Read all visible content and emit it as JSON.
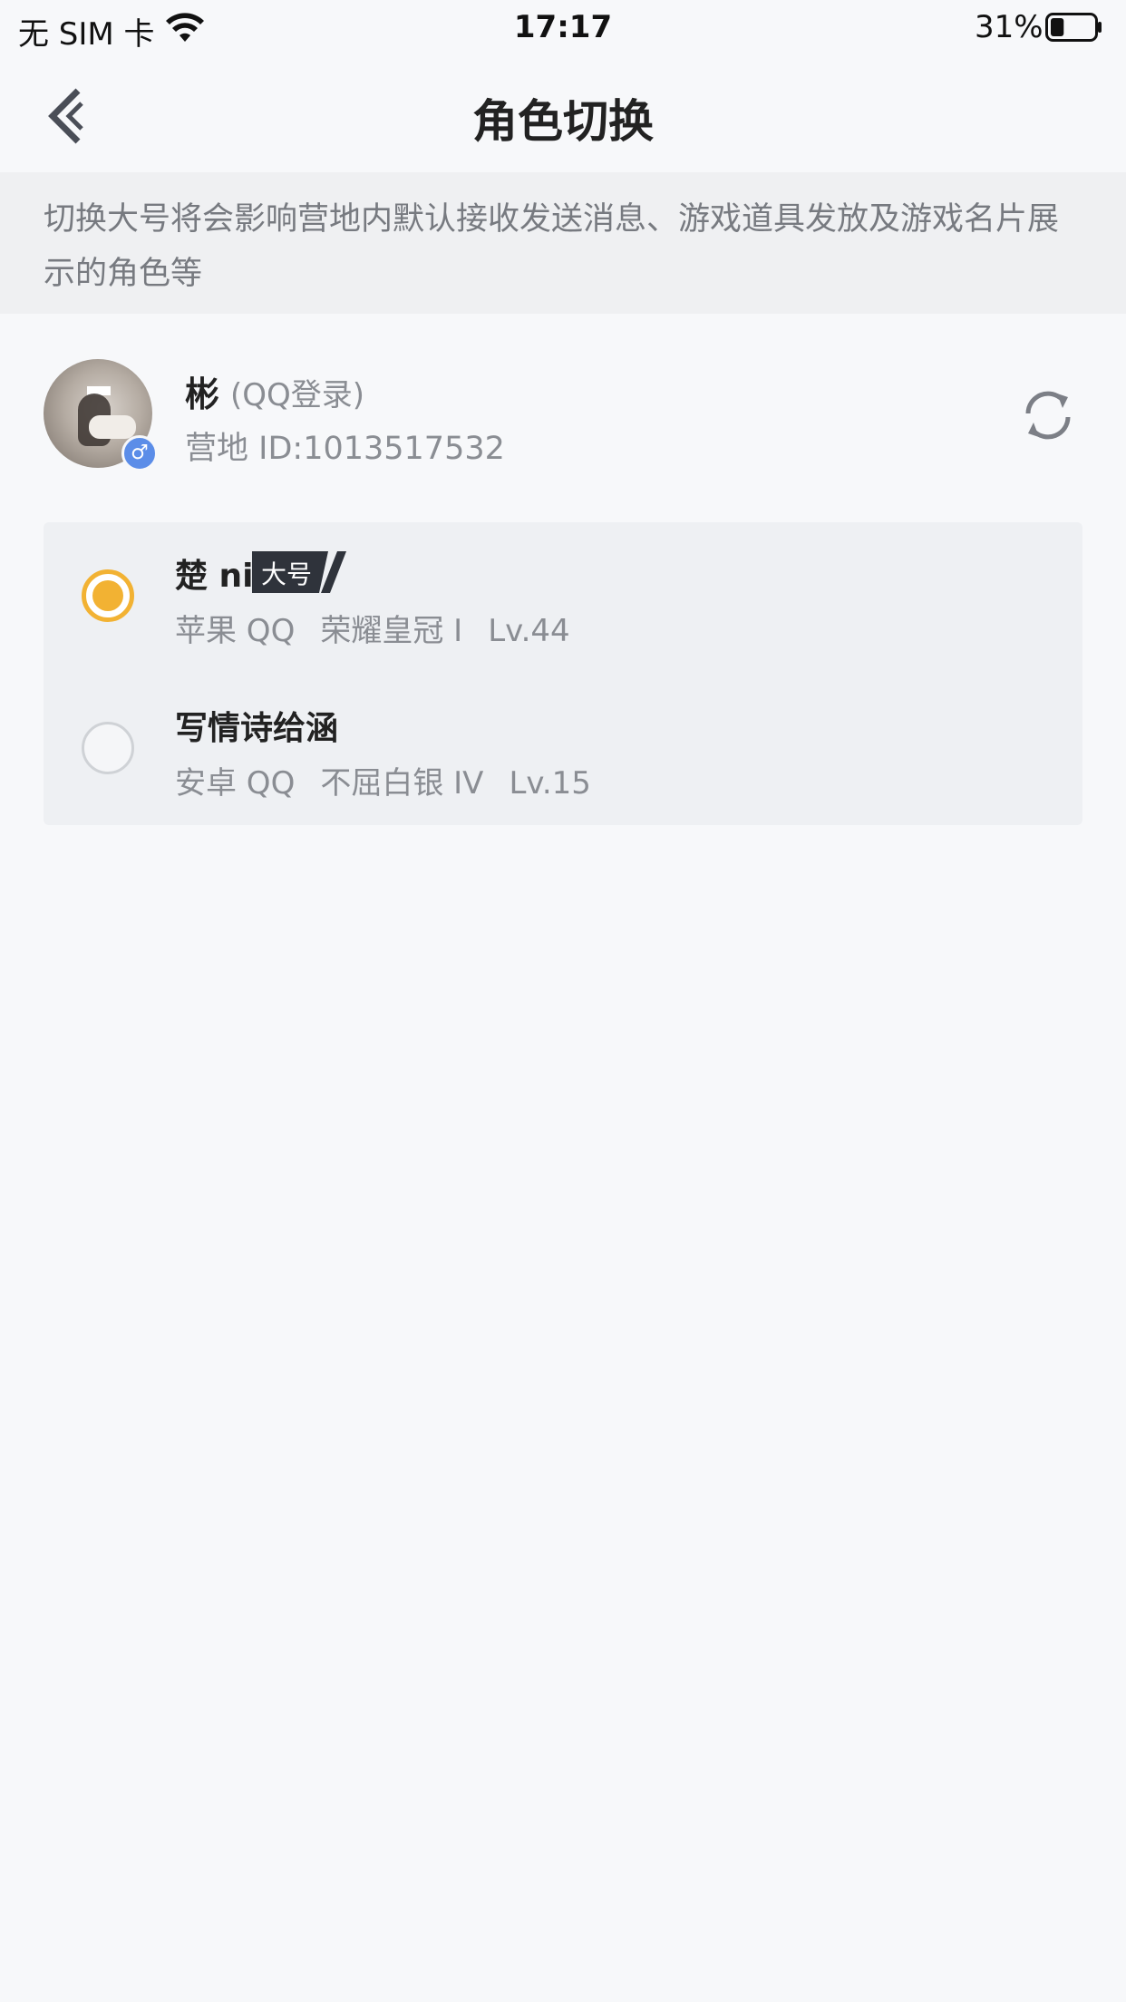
{
  "status_bar": {
    "carrier": "无 SIM 卡",
    "time": "17:17",
    "battery_percent": "31%",
    "battery_level": 0.31,
    "wifi_icon": "wifi-icon"
  },
  "nav": {
    "title": "角色切换",
    "back_icon": "chevron-left-icon"
  },
  "notice": {
    "text": "切换大号将会影响营地内默认接收发送消息、游戏道具发放及游戏名片展示的角色等"
  },
  "profile": {
    "name": "彬",
    "login_method": "(QQ登录)",
    "camp_id": "营地 ID:1013517532",
    "gender_symbol": "♂",
    "refresh_icon": "refresh-icon"
  },
  "roles": [
    {
      "name": "楚 ni",
      "badge": "大号",
      "platform": "苹果 QQ",
      "rank": "荣耀皇冠 I",
      "level": "Lv.44",
      "selected": true
    },
    {
      "name": "写情诗给涵",
      "badge": "",
      "platform": "安卓 QQ",
      "rank": "不屈白银 IV",
      "level": "Lv.15",
      "selected": false
    }
  ],
  "colors": {
    "accent": "#f2b233",
    "background": "#f7f8fa",
    "notice_bg": "#eff0f2",
    "card_bg": "#eef0f3",
    "gender_badge": "#5b8de8"
  }
}
